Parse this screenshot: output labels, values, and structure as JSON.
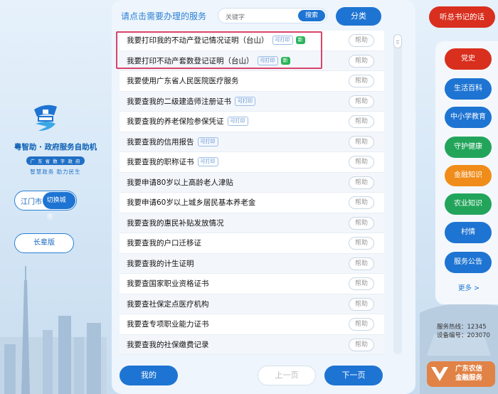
{
  "header": {
    "title": "请点击需要办理的服务",
    "search_placeholder": "关键字",
    "search_button": "搜索",
    "category_button": "分类"
  },
  "left": {
    "brand_line1": "粤智助 · 政府服务自助机",
    "brand_line2": "广 东 省 数 字 政 府",
    "brand_line3": "智慧政务   助力民生",
    "city": "江门市",
    "switch_city": "切换城市",
    "elder_mode": "长辈版"
  },
  "list": {
    "help_label": "帮助",
    "print_tag": "可打印",
    "new_tag": "新",
    "items": [
      {
        "label": "我要打印我的不动产登记情况证明（台山）",
        "print": true,
        "new": true
      },
      {
        "label": "我要打印不动产套数登记证明（台山）",
        "print": true,
        "new": true
      },
      {
        "label": "我要使用广东省人民医院医疗服务",
        "print": false,
        "new": false
      },
      {
        "label": "我要查我的二级建造师注册证书",
        "print": true,
        "new": false
      },
      {
        "label": "我要查我的养老保险参保凭证",
        "print": true,
        "new": false
      },
      {
        "label": "我要查我的信用报告",
        "print": true,
        "new": false
      },
      {
        "label": "我要查我的职称证书",
        "print": true,
        "new": false
      },
      {
        "label": "我要申请80岁以上高龄老人津贴",
        "print": false,
        "new": false
      },
      {
        "label": "我要申请60岁以上城乡居民基本养老金",
        "print": false,
        "new": false
      },
      {
        "label": "我要查我的惠民补贴发放情况",
        "print": false,
        "new": false
      },
      {
        "label": "我要查我的户口迁移证",
        "print": false,
        "new": false
      },
      {
        "label": "我要查我的计生证明",
        "print": false,
        "new": false
      },
      {
        "label": "我要查国家职业资格证书",
        "print": false,
        "new": false
      },
      {
        "label": "我要查社保定点医疗机构",
        "print": false,
        "new": false
      },
      {
        "label": "我要查专项职业能力证书",
        "print": false,
        "new": false
      },
      {
        "label": "我要查我的社保缴费记录",
        "print": false,
        "new": false
      }
    ]
  },
  "footer": {
    "my_button": "我的",
    "prev_button": "上一页",
    "next_button": "下一页"
  },
  "right": {
    "listen_button": "听总书记的话",
    "categories": [
      {
        "label": "党史",
        "color": "#d92f1e"
      },
      {
        "label": "生活百科",
        "color": "#1e74d2"
      },
      {
        "label": "中小学教育",
        "color": "#1e74d2"
      },
      {
        "label": "守护健康",
        "color": "#22a55a"
      },
      {
        "label": "金融知识",
        "color": "#f08c1a"
      },
      {
        "label": "农业知识",
        "color": "#22a55a"
      },
      {
        "label": "村情",
        "color": "#1e74d2"
      },
      {
        "label": "服务公告",
        "color": "#1e74d2"
      }
    ],
    "more": "更多 >",
    "hotline": "服务热线：12345",
    "device_no": "设备编号：203070",
    "bank_line1": "广东农信",
    "bank_line2": "金融服务"
  }
}
